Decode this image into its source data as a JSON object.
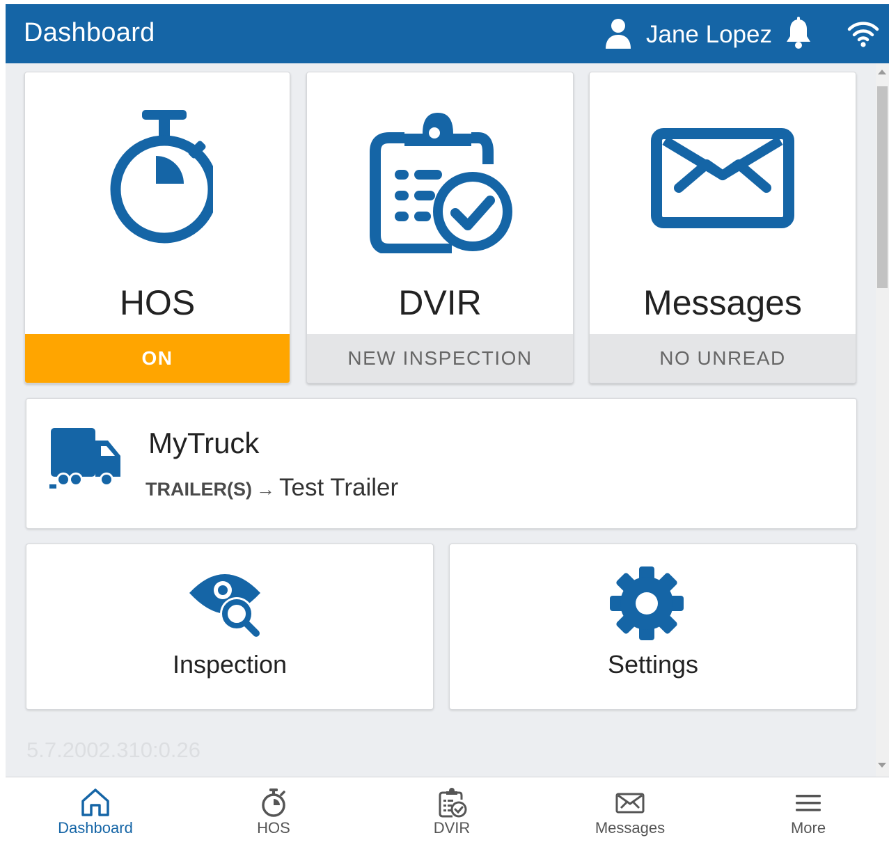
{
  "header": {
    "title": "Dashboard",
    "user_name": "Jane Lopez",
    "user_icon": "user-icon",
    "notification_icon": "bell-icon",
    "connection_icon": "wifi-icon"
  },
  "tiles": [
    {
      "label": "HOS",
      "status": "ON",
      "icon": "stopwatch-icon",
      "status_color": "#ffa500"
    },
    {
      "label": "DVIR",
      "status": "NEW INSPECTION",
      "icon": "clipboard-check-icon"
    },
    {
      "label": "Messages",
      "status": "NO UNREAD",
      "icon": "envelope-icon"
    }
  ],
  "vehicle": {
    "name": "MyTruck",
    "trailer_key": "TRAILER(S)",
    "arrow": "→",
    "trailer_value": "Test Trailer",
    "icon": "truck-icon"
  },
  "actions": [
    {
      "label": "Inspection",
      "icon": "eye-search-icon"
    },
    {
      "label": "Settings",
      "icon": "gear-icon"
    }
  ],
  "version": "5.7.2002.310:0.26",
  "bottom_nav": [
    {
      "label": "Dashboard",
      "icon": "home-icon",
      "active": true
    },
    {
      "label": "HOS",
      "icon": "stopwatch-icon"
    },
    {
      "label": "DVIR",
      "icon": "clipboard-check-icon"
    },
    {
      "label": "Messages",
      "icon": "envelope-icon"
    },
    {
      "label": "More",
      "icon": "hamburger-menu-icon"
    }
  ],
  "colors": {
    "brand_blue": "#1565a6",
    "hos_on": "#ffa500",
    "background": "#eceef1"
  }
}
